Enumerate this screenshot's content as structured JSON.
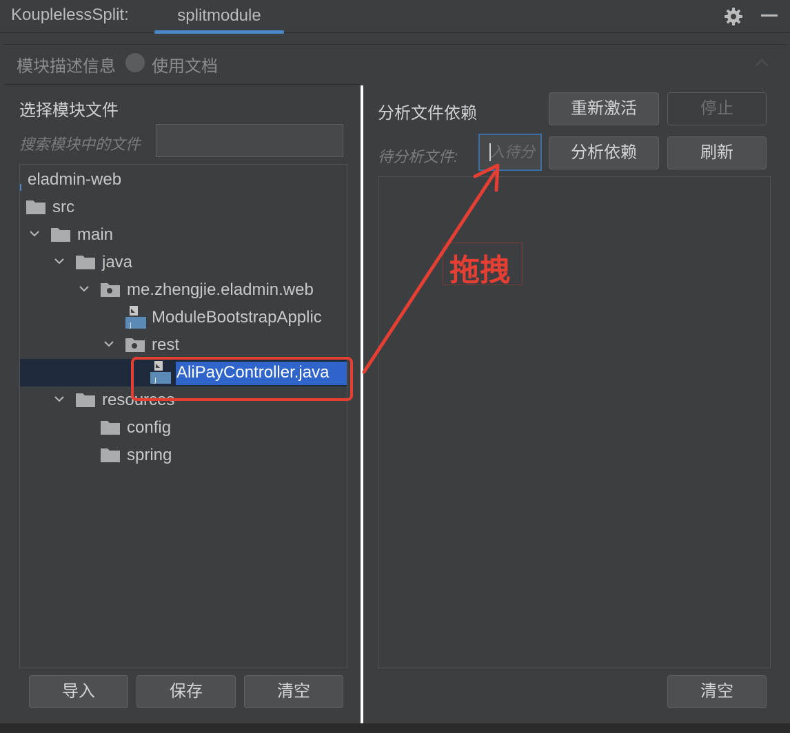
{
  "header": {
    "app_title": "KouplelessSplit:",
    "tab_label": "splitmodule",
    "settings_icon": "gear-icon",
    "minimize_icon": "minimize-icon"
  },
  "description": {
    "label": "模块描述信息",
    "doc_link": "使用文档",
    "collapse_icon": "chevron-up-icon"
  },
  "left": {
    "title": "选择模块文件",
    "search_label": "搜索模块中的文件",
    "search_value": "",
    "tree": [
      {
        "label": "eladmin-web",
        "icon": "module-icon",
        "expanded": null
      },
      {
        "label": "src",
        "icon": "folder-icon",
        "expanded": null
      },
      {
        "label": "main",
        "icon": "folder-icon",
        "expanded": true
      },
      {
        "label": "java",
        "icon": "folder-icon",
        "expanded": true
      },
      {
        "label": "me.zhengjie.eladmin.web",
        "icon": "package-icon",
        "expanded": true
      },
      {
        "label": "ModuleBootstrapApplic",
        "icon": "java-file-icon",
        "expanded": null
      },
      {
        "label": "rest",
        "icon": "package-icon",
        "expanded": true
      },
      {
        "label": "AliPayController.java",
        "icon": "java-file-icon",
        "expanded": null,
        "selected": true
      },
      {
        "label": "resources",
        "icon": "folder-icon",
        "expanded": true
      },
      {
        "label": "config",
        "icon": "folder-icon",
        "expanded": null
      },
      {
        "label": "spring",
        "icon": "folder-icon",
        "expanded": null
      }
    ],
    "buttons": {
      "import": "导入",
      "save": "保存",
      "clear": "清空"
    }
  },
  "right": {
    "title": "分析文件依赖",
    "reactivate": "重新激活",
    "stop": "停止",
    "pending_label": "待分析文件:",
    "pending_placeholder": "入待分",
    "analyze": "分析依赖",
    "refresh": "刷新",
    "clear": "清空"
  },
  "annotation": {
    "text": "拖拽",
    "color": "#e53e33"
  }
}
